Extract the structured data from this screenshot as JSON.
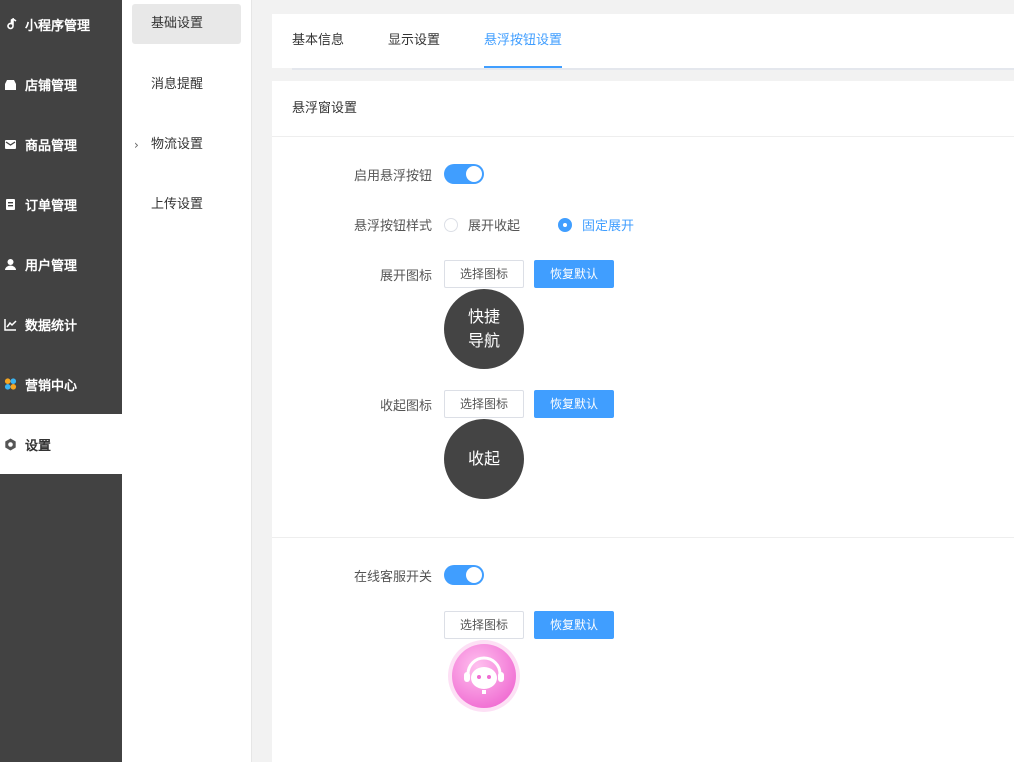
{
  "sidebar": {
    "items": [
      {
        "label": "小程序管理",
        "icon": "music-note-icon"
      },
      {
        "label": "店铺管理",
        "icon": "store-icon"
      },
      {
        "label": "商品管理",
        "icon": "envelope-icon"
      },
      {
        "label": "订单管理",
        "icon": "clipboard-icon"
      },
      {
        "label": "用户管理",
        "icon": "user-icon"
      },
      {
        "label": "数据统计",
        "icon": "chart-icon"
      },
      {
        "label": "营销中心",
        "icon": "marketing-icon"
      },
      {
        "label": "设置",
        "icon": "gear-icon"
      }
    ]
  },
  "subnav": {
    "items": [
      {
        "label": "基础设置"
      },
      {
        "label": "消息提醒"
      },
      {
        "label": "物流设置"
      },
      {
        "label": "上传设置"
      }
    ]
  },
  "tabs": [
    {
      "label": "基本信息"
    },
    {
      "label": "显示设置"
    },
    {
      "label": "悬浮按钮设置"
    }
  ],
  "panel": {
    "title": "悬浮窗设置",
    "enable_float": {
      "label": "启用悬浮按钮",
      "on": true
    },
    "float_style": {
      "label": "悬浮按钮样式",
      "options": [
        {
          "label": "展开收起",
          "checked": false
        },
        {
          "label": "固定展开",
          "checked": true
        }
      ]
    },
    "expand_icon": {
      "label": "展开图标",
      "select": "选择图标",
      "reset": "恢复默认",
      "circle_line1": "快捷",
      "circle_line2": "导航"
    },
    "collapse_icon": {
      "label": "收起图标",
      "select": "选择图标",
      "reset": "恢复默认",
      "circle_text": "收起"
    },
    "customer_service": {
      "label": "在线客服开关",
      "on": true,
      "select": "选择图标",
      "reset": "恢复默认"
    }
  },
  "colors": {
    "accent": "#409eff",
    "sidebar_bg": "#424242",
    "circle_bg": "#444444",
    "cs_pink": "#f77ed8"
  }
}
